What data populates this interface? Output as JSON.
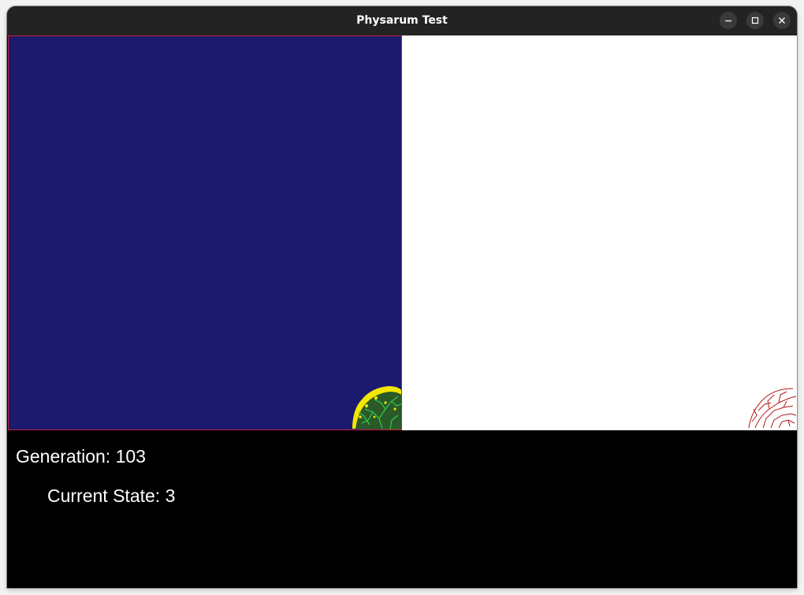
{
  "window": {
    "title": "Physarum Test",
    "controls": [
      "minimize",
      "maximize",
      "close"
    ]
  },
  "simulation": {
    "generation_label": "Generation: 103",
    "state_label": "Current State: 3"
  },
  "colors": {
    "field": "#1b1a6e",
    "field_border": "#c0203a",
    "growth_outer": "#f5e600",
    "growth_inner": "#22aa33",
    "trail": "#b31a1a",
    "status_bg": "#000000"
  }
}
